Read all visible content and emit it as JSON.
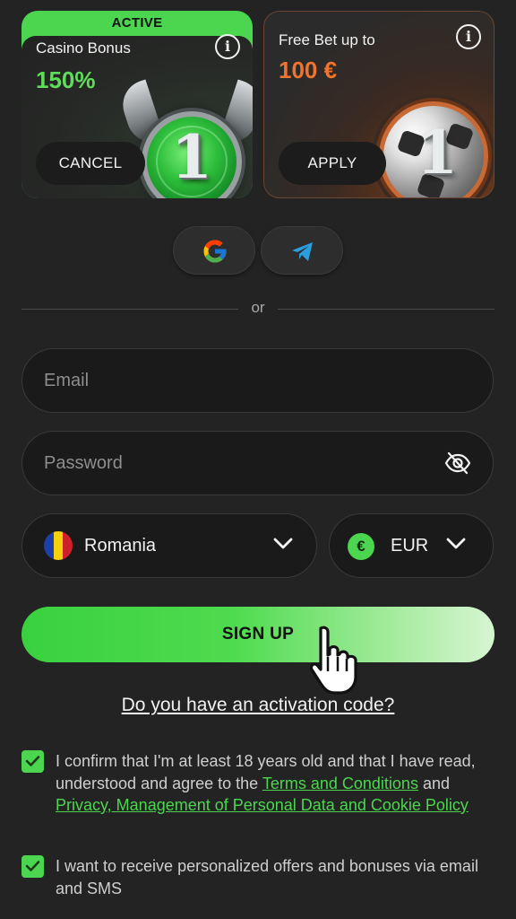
{
  "bonus_cards": {
    "casino": {
      "active_label": "ACTIVE",
      "title": "Casino Bonus",
      "value": "150%",
      "button_label": "CANCEL",
      "badge_number": "1"
    },
    "freebet": {
      "title": "Free Bet up to",
      "value": "100 €",
      "button_label": "APPLY",
      "badge_number": "1"
    },
    "info_icon_glyph": "i"
  },
  "social_login": {
    "providers": [
      "google-icon",
      "telegram-icon"
    ]
  },
  "divider": {
    "text": "or"
  },
  "form": {
    "email": {
      "placeholder": "Email",
      "value": ""
    },
    "password": {
      "placeholder": "Password",
      "value": ""
    },
    "country": {
      "selected": "Romania",
      "icon": "romania-flag-icon"
    },
    "currency": {
      "selected": "EUR",
      "symbol": "€"
    },
    "signup_label": "SIGN UP"
  },
  "activation_link": "Do you have an activation code?",
  "consents": {
    "age": {
      "checked": true,
      "text_before": "I confirm that I'm at least 18 years old and that I have read, understood and agree to the ",
      "terms_link": "Terms and Conditions",
      "text_middle": " and ",
      "privacy_link": "Privacy, Management of Personal Data and Cookie Policy"
    },
    "marketing": {
      "checked": true,
      "text": "I want to receive personalized offers and bonuses via email and SMS"
    }
  },
  "colors": {
    "background": "#232323",
    "accent_green": "#4cd64f",
    "accent_orange": "#f0742d"
  }
}
